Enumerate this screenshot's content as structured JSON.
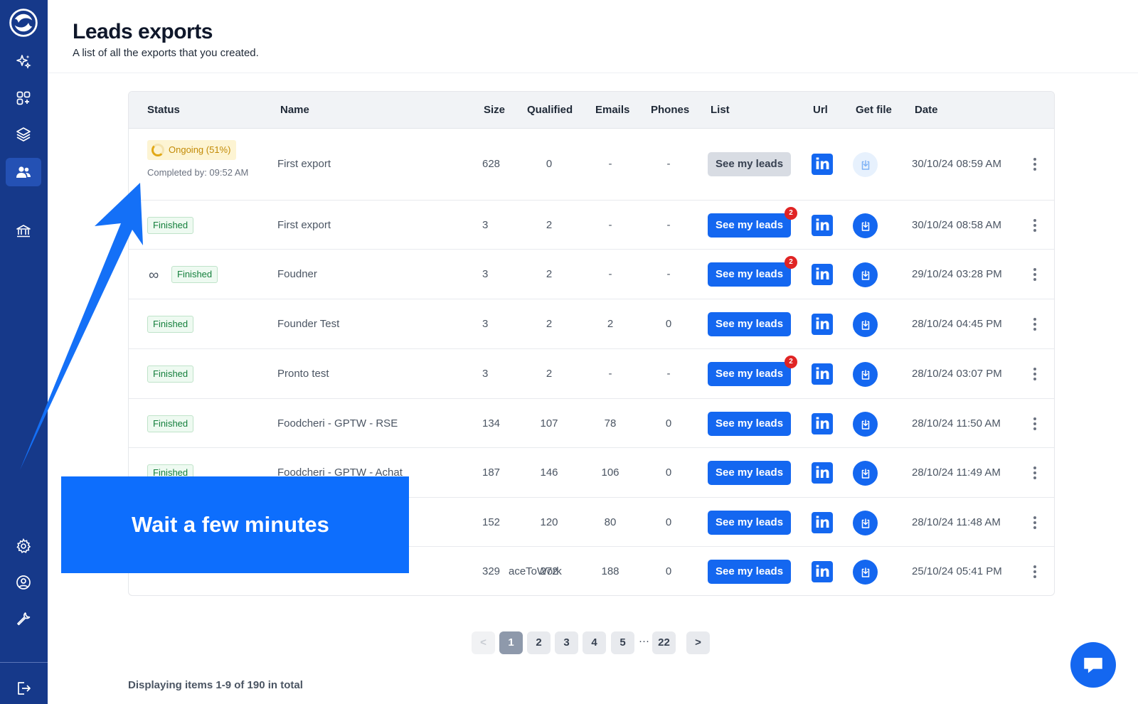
{
  "header": {
    "title": "Leads exports",
    "subtitle": "A list of all the exports that you created."
  },
  "sidebar": {
    "items": [
      {
        "icon": "logo-icon"
      },
      {
        "icon": "sparkles-icon"
      },
      {
        "icon": "apps-add-icon"
      },
      {
        "icon": "layers-icon"
      },
      {
        "icon": "users-icon",
        "active": true
      },
      {
        "icon": "bank-icon"
      },
      {
        "icon": "gear-icon"
      },
      {
        "icon": "user-circle-icon"
      },
      {
        "icon": "wrench-icon"
      },
      {
        "icon": "logout-icon"
      }
    ]
  },
  "table": {
    "columns": [
      "Status",
      "Name",
      "Size",
      "Qualified",
      "Emails",
      "Phones",
      "List",
      "Url",
      "Get file",
      "Date"
    ],
    "see_leads_label": "See my leads",
    "linkedin_label": "in",
    "rows": [
      {
        "status": "Ongoing (51%)",
        "completed_by": "Completed by: 09:52 AM",
        "name": "First export",
        "size": "628",
        "qualified": "0",
        "emails": "-",
        "phones": "-",
        "badge": "",
        "date": "30/10/24 08:59 AM"
      },
      {
        "status": "Finished",
        "name": "First export",
        "size": "3",
        "qualified": "2",
        "emails": "-",
        "phones": "-",
        "badge": "2",
        "date": "30/10/24 08:58 AM"
      },
      {
        "status": "Finished",
        "name": "Foudner",
        "size": "3",
        "qualified": "2",
        "emails": "-",
        "phones": "-",
        "badge": "2",
        "date": "29/10/24 03:28 PM"
      },
      {
        "status": "Finished",
        "name": "Founder Test",
        "size": "3",
        "qualified": "2",
        "emails": "2",
        "phones": "0",
        "badge": "",
        "date": "28/10/24 04:45 PM"
      },
      {
        "status": "Finished",
        "name": "Pronto test",
        "size": "3",
        "qualified": "2",
        "emails": "-",
        "phones": "-",
        "badge": "2",
        "date": "28/10/24 03:07 PM"
      },
      {
        "status": "Finished",
        "name": "Foodcheri - GPTW - RSE",
        "size": "134",
        "qualified": "107",
        "emails": "78",
        "phones": "0",
        "badge": "",
        "date": "28/10/24 11:50 AM"
      },
      {
        "status": "Finished",
        "name": "Foodcheri - GPTW - Achat",
        "size": "187",
        "qualified": "146",
        "emails": "106",
        "phones": "0",
        "badge": "",
        "date": "28/10/24 11:49 AM"
      },
      {
        "status": "",
        "name": "",
        "size": "152",
        "qualified": "120",
        "emails": "80",
        "phones": "0",
        "badge": "",
        "date": "28/10/24 11:48 AM"
      },
      {
        "status": "",
        "name": "aceToWork",
        "size": "329",
        "qualified": "272",
        "emails": "188",
        "phones": "0",
        "badge": "",
        "date": "25/10/24 05:41 PM"
      }
    ]
  },
  "pagination": {
    "prev": "<",
    "pages": [
      "1",
      "2",
      "3",
      "4",
      "5"
    ],
    "ellipsis": "···",
    "last": "22",
    "next": ">",
    "current": "1"
  },
  "footer": {
    "info": "Displaying items 1-9 of 190 in total"
  },
  "overlay": {
    "text": "Wait a few minutes"
  },
  "colors": {
    "sidebar": "#16398a",
    "accent": "#1467f0",
    "finished_green": "#15803d",
    "ongoing_amber": "#c28a06"
  }
}
